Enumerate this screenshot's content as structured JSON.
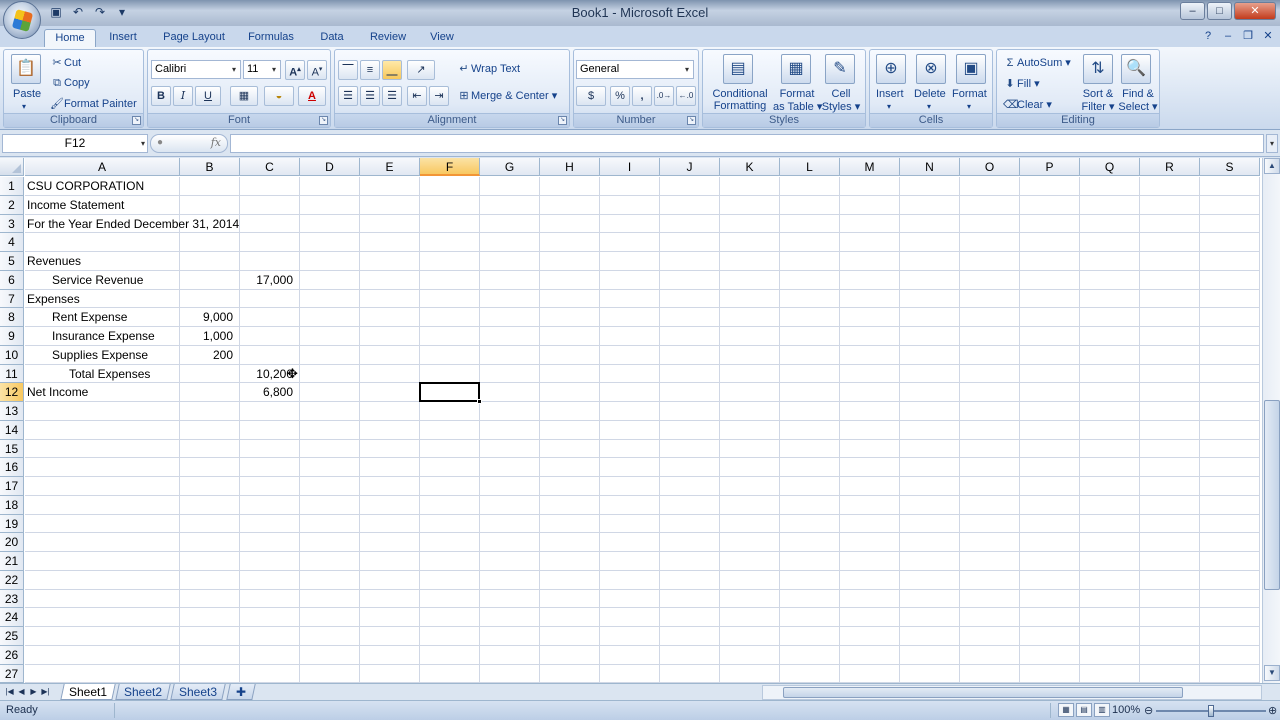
{
  "window": {
    "title": "Book1 - Microsoft Excel"
  },
  "tabs": [
    "Home",
    "Insert",
    "Page Layout",
    "Formulas",
    "Data",
    "Review",
    "View"
  ],
  "ribbon": {
    "clipboard": {
      "label": "Clipboard",
      "paste": "Paste",
      "cut": "Cut",
      "copy": "Copy",
      "format_painter": "Format Painter"
    },
    "font": {
      "label": "Font",
      "name": "Calibri",
      "size": "11",
      "bold": "B",
      "italic": "I",
      "underline": "U"
    },
    "alignment": {
      "label": "Alignment",
      "wrap_text": "Wrap Text",
      "merge_center": "Merge & Center"
    },
    "number": {
      "label": "Number",
      "format": "General",
      "currency": "$",
      "percent": "%",
      "comma": ","
    },
    "styles": {
      "label": "Styles",
      "conditional_1": "Conditional",
      "conditional_2": "Formatting",
      "format_table_1": "Format",
      "format_table_2": "as Table",
      "cell_styles_1": "Cell",
      "cell_styles_2": "Styles"
    },
    "cells": {
      "label": "Cells",
      "insert": "Insert",
      "delete": "Delete",
      "format": "Format"
    },
    "editing": {
      "label": "Editing",
      "autosum": "AutoSum",
      "fill": "Fill",
      "clear": "Clear",
      "sort_1": "Sort &",
      "sort_2": "Filter",
      "find_1": "Find &",
      "find_2": "Select"
    }
  },
  "formula_bar": {
    "name_box": "F12",
    "fx": "fx",
    "content": ""
  },
  "columns": [
    "A",
    "B",
    "C",
    "D",
    "E",
    "F",
    "G",
    "H",
    "I",
    "J",
    "K",
    "L",
    "M",
    "N",
    "O",
    "P",
    "Q",
    "R",
    "S"
  ],
  "rows": [
    "1",
    "2",
    "3",
    "4",
    "5",
    "6",
    "7",
    "8",
    "9",
    "10",
    "11",
    "12",
    "13",
    "14",
    "15",
    "16",
    "17",
    "18",
    "19",
    "20",
    "21",
    "22",
    "23",
    "24",
    "25",
    "26",
    "27"
  ],
  "cells": {
    "a1": "CSU CORPORATION",
    "a2": "Income Statement",
    "a3": "For the Year Ended December 31, 2014",
    "a5": "Revenues",
    "a6": "Service Revenue",
    "c6": "17,000",
    "a7": "Expenses",
    "a8": "Rent Expense",
    "b8": "9,000",
    "a9": "Insurance Expense",
    "b9": "1,000",
    "a10": "Supplies Expense",
    "b10": "200",
    "a11": "Total Expenses",
    "c11": "10,200",
    "a12": "Net Income",
    "c12": "6,800"
  },
  "sheet_tabs": [
    "Sheet1",
    "Sheet2",
    "Sheet3"
  ],
  "status": {
    "text": "Ready",
    "zoom": "100%"
  }
}
